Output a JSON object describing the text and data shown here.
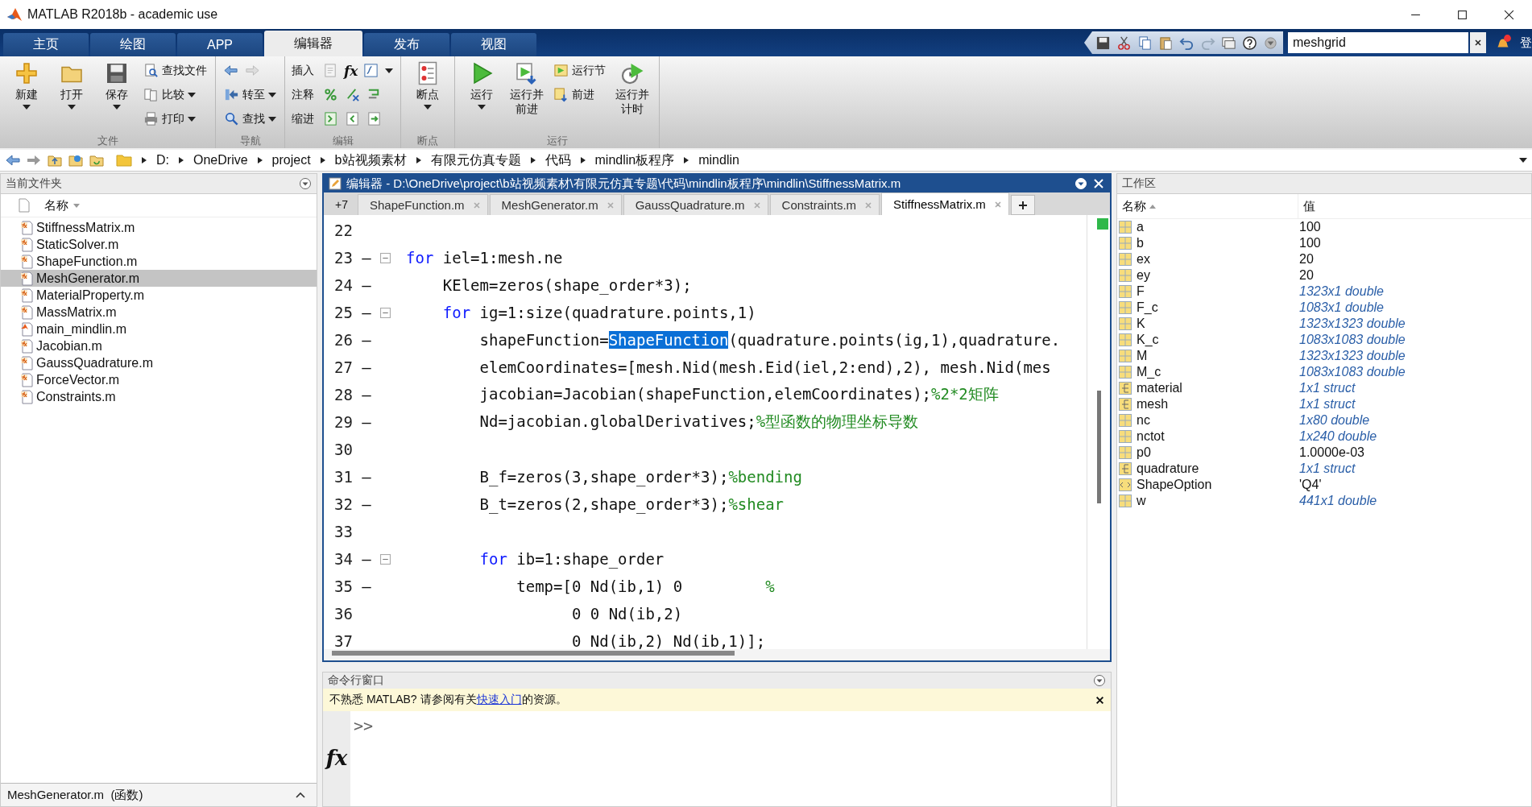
{
  "window": {
    "title": "MATLAB R2018b - academic use"
  },
  "tabs": [
    {
      "label": "主页",
      "selected": false
    },
    {
      "label": "绘图",
      "selected": false
    },
    {
      "label": "APP",
      "selected": false
    },
    {
      "label": "编辑器",
      "selected": true
    },
    {
      "label": "发布",
      "selected": false
    },
    {
      "label": "视图",
      "selected": false
    }
  ],
  "quick_search": {
    "value": "meshgrid"
  },
  "login": "登",
  "ribbon": [
    {
      "label": "文件",
      "items": [
        {
          "kind": "large",
          "label": "新建",
          "dropdown": true
        },
        {
          "kind": "large",
          "label": "打开",
          "dropdown": true
        },
        {
          "kind": "large",
          "label": "保存",
          "dropdown": true
        },
        {
          "kind": "small",
          "label": "查找文件",
          "dropdown": false
        },
        {
          "kind": "small",
          "label": "比较",
          "dropdown": true
        },
        {
          "kind": "small",
          "label": "打印",
          "dropdown": true
        }
      ]
    },
    {
      "label": "导航",
      "items": [
        {
          "kind": "small"
        },
        {
          "kind": "small",
          "label": "转至",
          "dropdown": true
        },
        {
          "kind": "small",
          "label": "查找",
          "dropdown": true
        }
      ]
    },
    {
      "label": "编辑",
      "items": [
        {
          "kind": "row",
          "label": "插入",
          "glyph": "fx",
          "dropdown": true
        },
        {
          "kind": "row",
          "label": "注释",
          "dropdown": false
        },
        {
          "kind": "row",
          "label": "缩进",
          "dropdown": false
        }
      ]
    },
    {
      "label": "断点",
      "items": [
        {
          "kind": "large",
          "label": "断点",
          "dropdown": true
        }
      ]
    },
    {
      "label": "运行",
      "items": [
        {
          "kind": "large",
          "label": "运行",
          "dropdown": true
        },
        {
          "kind": "large",
          "label": "运行并前进",
          "dropdown": false
        },
        {
          "kind": "small",
          "label": "运行节",
          "dropdown": false
        },
        {
          "kind": "small",
          "label": "前进",
          "dropdown": false
        },
        {
          "kind": "large",
          "label": "运行并计时",
          "dropdown": false
        }
      ]
    }
  ],
  "address_bar": [
    "D:",
    "OneDrive",
    "project",
    "b站视频素材",
    "有限元仿真专题",
    "代码",
    "mindlin板程序",
    "mindlin"
  ],
  "current_folder": {
    "title": "当前文件夹",
    "column": "名称",
    "files": [
      {
        "name": "StiffnessMatrix.m",
        "kind": "function",
        "selected": false
      },
      {
        "name": "StaticSolver.m",
        "kind": "function",
        "selected": false
      },
      {
        "name": "ShapeFunction.m",
        "kind": "function",
        "selected": false
      },
      {
        "name": "MeshGenerator.m",
        "kind": "function",
        "selected": true
      },
      {
        "name": "MaterialProperty.m",
        "kind": "function",
        "selected": false
      },
      {
        "name": "MassMatrix.m",
        "kind": "function",
        "selected": false
      },
      {
        "name": "main_mindlin.m",
        "kind": "script",
        "selected": false
      },
      {
        "name": "Jacobian.m",
        "kind": "function",
        "selected": false
      },
      {
        "name": "GaussQuadrature.m",
        "kind": "function",
        "selected": false
      },
      {
        "name": "ForceVector.m",
        "kind": "function",
        "selected": false
      },
      {
        "name": "Constraints.m",
        "kind": "function",
        "selected": false
      }
    ],
    "details": "MeshGenerator.m  (函数)"
  },
  "editor": {
    "title": "编辑器 - D:\\OneDrive\\project\\b站视频素材\\有限元仿真专题\\代码\\mindlin板程序\\mindlin\\StiffnessMatrix.m",
    "overflow": "+7",
    "tabs": [
      {
        "label": "ShapeFunction.m",
        "selected": false
      },
      {
        "label": "MeshGenerator.m",
        "selected": false
      },
      {
        "label": "GaussQuadrature.m",
        "selected": false
      },
      {
        "label": "Constraints.m",
        "selected": false
      },
      {
        "label": "StiffnessMatrix.m",
        "selected": true
      }
    ],
    "lines": [
      {
        "number": "22"
      },
      {
        "number": "23",
        "marker": "—",
        "fold": true,
        "segments": [
          {
            "kind": "keyword",
            "text": "for"
          },
          {
            "kind": "code",
            "text": " iel=1:mesh.ne"
          }
        ]
      },
      {
        "number": "24",
        "marker": "—",
        "segments": [
          {
            "kind": "code",
            "text": "    KElem=zeros(shape_order*3);"
          }
        ]
      },
      {
        "number": "25",
        "marker": "—",
        "fold": true,
        "segments": [
          {
            "kind": "keyword",
            "text": "    for"
          },
          {
            "kind": "code",
            "text": " ig=1:size(quadrature.points,1)"
          }
        ]
      },
      {
        "number": "26",
        "marker": "—",
        "segments": [
          {
            "kind": "code",
            "text": "        shapeFunction="
          },
          {
            "kind": "selection",
            "text": "ShapeFunction"
          },
          {
            "kind": "code",
            "text": "(quadrature.points(ig,1),quadrature."
          }
        ]
      },
      {
        "number": "27",
        "marker": "—",
        "segments": [
          {
            "kind": "code",
            "text": "        elemCoordinates=[mesh.Nid(mesh.Eid(iel,2:end),2), mesh.Nid(mes"
          }
        ]
      },
      {
        "number": "28",
        "marker": "—",
        "segments": [
          {
            "kind": "code",
            "text": "        jacobian=Jacobian(shapeFunction,elemCoordinates);"
          },
          {
            "kind": "comment",
            "text": "%2*2矩阵"
          }
        ]
      },
      {
        "number": "29",
        "marker": "—",
        "segments": [
          {
            "kind": "code",
            "text": "        Nd=jacobian.globalDerivatives;"
          },
          {
            "kind": "comment",
            "text": "%型函数的物理坐标导数"
          }
        ]
      },
      {
        "number": "30"
      },
      {
        "number": "31",
        "marker": "—",
        "segments": [
          {
            "kind": "code",
            "text": "        B_f=zeros(3,shape_order*3);"
          },
          {
            "kind": "comment",
            "text": "%bending"
          }
        ]
      },
      {
        "number": "32",
        "marker": "—",
        "segments": [
          {
            "kind": "code",
            "text": "        B_t=zeros(2,shape_order*3);"
          },
          {
            "kind": "comment",
            "text": "%shear"
          }
        ]
      },
      {
        "number": "33"
      },
      {
        "number": "34",
        "marker": "—",
        "fold": true,
        "segments": [
          {
            "kind": "keyword",
            "text": "        for"
          },
          {
            "kind": "code",
            "text": " ib=1:shape_order"
          }
        ]
      },
      {
        "number": "35",
        "marker": "—",
        "segments": [
          {
            "kind": "code",
            "text": "            temp=[0 Nd(ib,1) 0         "
          },
          {
            "kind": "comment",
            "text": "%"
          }
        ]
      },
      {
        "number": "36",
        "segments": [
          {
            "kind": "code",
            "text": "                  0 0 Nd(ib,2)"
          }
        ]
      },
      {
        "number": "37",
        "segments": [
          {
            "kind": "code",
            "text": "                  0 Nd(ib,2) Nd(ib,1)];"
          }
        ]
      }
    ]
  },
  "command_window": {
    "title": "命令行窗口",
    "notice_before": "不熟悉 MATLAB? 请参阅有关",
    "notice_link": "快速入门",
    "notice_after": "的资源。",
    "function_browser": "fx",
    "prompt": ">>"
  },
  "workspace": {
    "title": "工作区",
    "columns": [
      "名称",
      "值"
    ],
    "variables": [
      {
        "name": "a",
        "value": "100",
        "kind": "matrix",
        "summary": false
      },
      {
        "name": "b",
        "value": "100",
        "kind": "matrix",
        "summary": false
      },
      {
        "name": "ex",
        "value": "20",
        "kind": "matrix",
        "summary": false
      },
      {
        "name": "ey",
        "value": "20",
        "kind": "matrix",
        "summary": false
      },
      {
        "name": "F",
        "value": "1323x1 double",
        "kind": "matrix",
        "summary": true
      },
      {
        "name": "F_c",
        "value": "1083x1 double",
        "kind": "matrix",
        "summary": true
      },
      {
        "name": "K",
        "value": "1323x1323 double",
        "kind": "matrix",
        "summary": true
      },
      {
        "name": "K_c",
        "value": "1083x1083 double",
        "kind": "matrix",
        "summary": true
      },
      {
        "name": "M",
        "value": "1323x1323 double",
        "kind": "matrix",
        "summary": true
      },
      {
        "name": "M_c",
        "value": "1083x1083 double",
        "kind": "matrix",
        "summary": true
      },
      {
        "name": "material",
        "value": "1x1 struct",
        "kind": "struct",
        "summary": true
      },
      {
        "name": "mesh",
        "value": "1x1 struct",
        "kind": "struct",
        "summary": true
      },
      {
        "name": "nc",
        "value": "1x80 double",
        "kind": "matrix",
        "summary": true
      },
      {
        "name": "nctot",
        "value": "1x240 double",
        "kind": "matrix",
        "summary": true
      },
      {
        "name": "p0",
        "value": "1.0000e-03",
        "kind": "matrix",
        "summary": false
      },
      {
        "name": "quadrature",
        "value": "1x1 struct",
        "kind": "struct",
        "summary": true
      },
      {
        "name": "ShapeOption",
        "value": "'Q4'",
        "kind": "char",
        "summary": false
      },
      {
        "name": "w",
        "value": "441x1 double",
        "kind": "matrix",
        "summary": true
      }
    ]
  }
}
